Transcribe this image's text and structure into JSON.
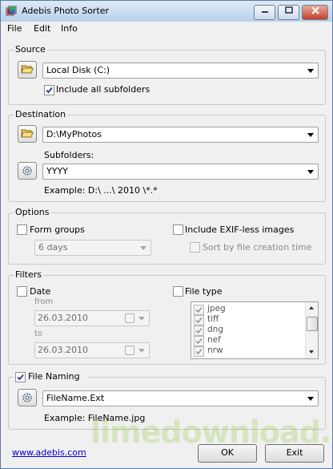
{
  "window": {
    "title": "Adebis Photo Sorter"
  },
  "menu": {
    "file": "File",
    "edit": "Edit",
    "info": "Info"
  },
  "source": {
    "legend": "Source",
    "drive": "Local Disk (C:)",
    "include_subfolders_label": "Include all subfolders",
    "include_subfolders_checked": true
  },
  "destination": {
    "legend": "Destination",
    "path": "D:\\MyPhotos",
    "subfolders_label": "Subfolders:",
    "subfolders_pattern": "YYYY",
    "example": "Example: D:\\ ...\\ 2010 \\*.*"
  },
  "options": {
    "legend": "Options",
    "form_groups_label": "Form groups",
    "form_groups_checked": false,
    "group_interval": "6 days",
    "include_exif_less_label": "Include EXIF-less images",
    "include_exif_less_checked": false,
    "sort_by_creation_label": "Sort by file creation time",
    "sort_by_creation_checked": false
  },
  "filters": {
    "legend": "Filters",
    "date_label": "Date",
    "date_checked": false,
    "from_label": "from",
    "from_value": "26.03.2010",
    "to_label": "to",
    "to_value": "26.03.2010",
    "file_type_label": "File type",
    "file_type_checked": false,
    "file_types": [
      "jpeg",
      "tiff",
      "dng",
      "nef",
      "nrw"
    ]
  },
  "naming": {
    "legend": "File Naming",
    "checked": true,
    "pattern": "FileName.Ext",
    "example": "Example: FileName.jpg"
  },
  "footer": {
    "link": "www.adebis.com",
    "ok": "OK",
    "exit": "Exit",
    "watermark": "limedownload.com"
  }
}
